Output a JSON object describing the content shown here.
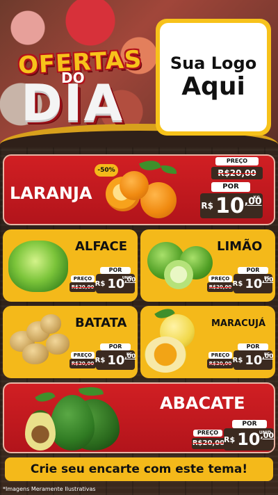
{
  "header": {
    "title_ofertas": "OFERTAS",
    "title_do": "DO",
    "title_dia": "DIA",
    "logo_line1": "Sua Logo",
    "logo_line2": "Aqui"
  },
  "products": {
    "laranja": {
      "name": "LARANJA",
      "badge": "-50%",
      "preco_label": "PREÇO",
      "old_price": "R$20,00",
      "por_label": "POR",
      "currency": "R$",
      "price_int": "10",
      "price_dec": ",00",
      "unit": "KG"
    },
    "alface": {
      "name": "ALFACE",
      "preco_label": "PREÇO",
      "old_price": "R$20,00",
      "por_label": "POR",
      "currency": "R$",
      "price_int": "10",
      "price_dec": ",00",
      "unit": "UNID"
    },
    "limao": {
      "name": "LIMÃO",
      "preco_label": "PREÇO",
      "old_price": "R$20,00",
      "por_label": "POR",
      "currency": "R$",
      "price_int": "10",
      "price_dec": ",00",
      "unit": "KG"
    },
    "batata": {
      "name": "BATATA",
      "preco_label": "PREÇO",
      "old_price": "R$20,00",
      "por_label": "POR",
      "currency": "R$",
      "price_int": "10",
      "price_dec": ",00",
      "unit": "KG"
    },
    "maracuja": {
      "name": "MARACUJÁ",
      "preco_label": "PREÇO",
      "old_price": "R$20,00",
      "por_label": "POR",
      "currency": "R$",
      "price_int": "10",
      "price_dec": ",00",
      "unit": "KG"
    },
    "abacate": {
      "name": "ABACATE",
      "preco_label": "PREÇO",
      "old_price": "R$20,00",
      "por_label": "POR",
      "currency": "R$",
      "price_int": "10",
      "price_dec": ",00",
      "unit": "UNID"
    }
  },
  "footer": {
    "cta": "Crie seu encarte com este tema!",
    "disclaimer": "*Imagens Meramente Ilustrativas"
  },
  "colors": {
    "red": "#d11f23",
    "yellow": "#f4b91a",
    "wood": "#3b2a20"
  }
}
